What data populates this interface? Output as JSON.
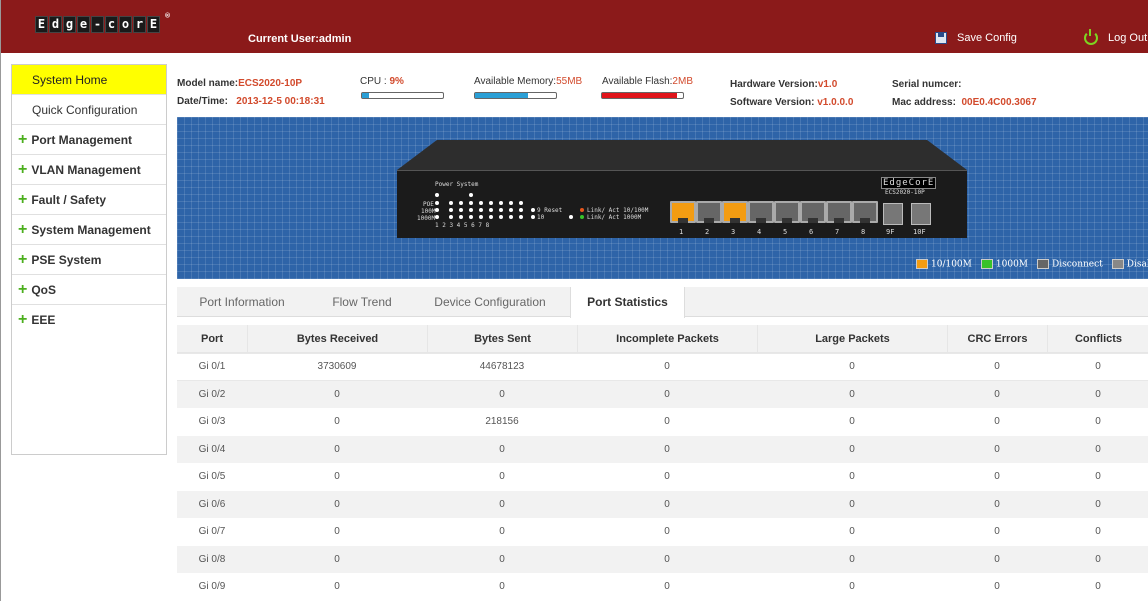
{
  "brand": {
    "letters": [
      "E",
      "d",
      "g",
      "e",
      "-",
      "c",
      "o",
      "r",
      "E"
    ],
    "reg": "®"
  },
  "header": {
    "current_user": "Current User:admin",
    "save_label": "Save Config",
    "logout_label": "Log Out"
  },
  "sidebar": {
    "items": [
      {
        "label": "System Home",
        "type": "link",
        "active": true
      },
      {
        "label": "Quick Configuration",
        "type": "link"
      },
      {
        "label": "Port Management",
        "type": "group"
      },
      {
        "label": "VLAN Management",
        "type": "group"
      },
      {
        "label": "Fault / Safety",
        "type": "group"
      },
      {
        "label": "System Management",
        "type": "group"
      },
      {
        "label": "PSE System",
        "type": "group"
      },
      {
        "label": "QoS",
        "type": "group"
      },
      {
        "label": "EEE",
        "type": "group"
      }
    ],
    "plus_glyph": "+"
  },
  "info": {
    "model_label": "Model name:",
    "model_value": "ECS2020-10P",
    "datetime_label": "Date/Time:",
    "datetime_value": "2013-12-5 00:18:31",
    "cpu_label": "CPU :",
    "cpu_value": "9%",
    "cpu_fraction": 0.09,
    "memory_label": "Available Memory:",
    "memory_value": "55MB",
    "memory_fraction": 0.65,
    "flash_label": "Available Flash:",
    "flash_value": "2MB",
    "flash_fraction": 0.92,
    "hw_label": "Hardware Version:",
    "hw_value": "v1.0",
    "sw_label": "Software Version:",
    "sw_value": "v1.0.0.0",
    "serial_label": "Serial numcer:",
    "mac_label": "Mac address:",
    "mac_value": "00E0.4C00.3067"
  },
  "device": {
    "power_system": "Power System",
    "poe": "POE",
    "m100": "100M",
    "m1000": "1000M",
    "led_numbers": "1  2  3  4  5  6  7  8",
    "nine_reset": "9 Reset",
    "ten": "10",
    "link_act_10_100": "Link/ Act 10/100M",
    "link_act_1000": "Link/ Act 1000M",
    "model_plate": "ECS2020-10P",
    "ports": [
      "1",
      "2",
      "3",
      "4",
      "5",
      "6",
      "7",
      "8"
    ],
    "active_ports": [
      1,
      3
    ],
    "sfp_ports": [
      "9F",
      "10F"
    ],
    "legend": [
      "10/100M",
      "1000M",
      "Disconnect",
      "Disabl"
    ]
  },
  "tabs": [
    "Port Information",
    "Flow Trend",
    "Device Configuration",
    "Port Statistics"
  ],
  "table": {
    "headers": [
      "Port",
      "Bytes Received",
      "Bytes Sent",
      "Incomplete Packets",
      "Large Packets",
      "CRC Errors",
      "Conflicts"
    ],
    "rows": [
      [
        "Gi 0/1",
        "3730609",
        "44678123",
        "0",
        "0",
        "0",
        "0"
      ],
      [
        "Gi 0/2",
        "0",
        "0",
        "0",
        "0",
        "0",
        "0"
      ],
      [
        "Gi 0/3",
        "0",
        "218156",
        "0",
        "0",
        "0",
        "0"
      ],
      [
        "Gi 0/4",
        "0",
        "0",
        "0",
        "0",
        "0",
        "0"
      ],
      [
        "Gi 0/5",
        "0",
        "0",
        "0",
        "0",
        "0",
        "0"
      ],
      [
        "Gi 0/6",
        "0",
        "0",
        "0",
        "0",
        "0",
        "0"
      ],
      [
        "Gi 0/7",
        "0",
        "0",
        "0",
        "0",
        "0",
        "0"
      ],
      [
        "Gi 0/8",
        "0",
        "0",
        "0",
        "0",
        "0",
        "0"
      ],
      [
        "Gi 0/9",
        "0",
        "0",
        "0",
        "0",
        "0",
        "0"
      ]
    ]
  },
  "colors": {
    "header_bg": "#8b1a1a",
    "active_nav": "#ffff00",
    "panel_bg": "#2e64a8",
    "value_red": "#d24a2c",
    "plus_green": "#4caf1e",
    "cpu_bar": "#2a9fd6",
    "flash_bar": "#e0141a"
  }
}
